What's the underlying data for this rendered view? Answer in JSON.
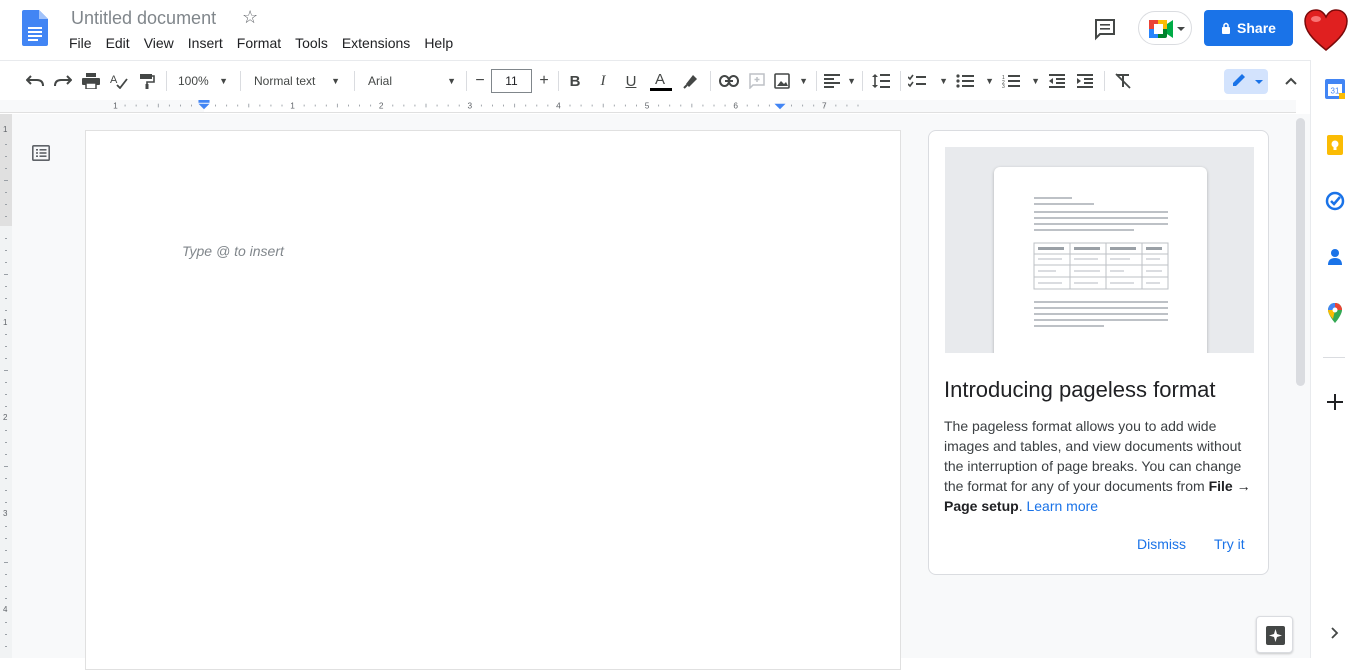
{
  "header": {
    "title": "Untitled document",
    "menu": [
      "File",
      "Edit",
      "View",
      "Insert",
      "Format",
      "Tools",
      "Extensions",
      "Help"
    ],
    "share_label": "Share"
  },
  "toolbar": {
    "zoom": "100%",
    "style": "Normal text",
    "font": "Arial",
    "font_size": "11"
  },
  "ruler": {
    "labels": [
      "1",
      "1",
      "2",
      "3",
      "4",
      "5",
      "6",
      "7"
    ]
  },
  "vruler": {
    "labels": [
      "1",
      "1",
      "2",
      "3",
      "4"
    ]
  },
  "document": {
    "placeholder": "Type @ to insert"
  },
  "promo": {
    "title": "Introducing pageless format",
    "body_1": "The pageless format allows you to add wide images and tables, and view documents without the interruption of page breaks. You can change the format for any of your documents from ",
    "body_bold_1": "File → Page setup",
    "body_2": ". ",
    "learn_more": "Learn more",
    "dismiss": "Dismiss",
    "try_it": "Try it"
  },
  "side_panel": {
    "calendar_day": "31",
    "icons": [
      "calendar-icon",
      "keep-icon",
      "tasks-icon",
      "contacts-icon",
      "maps-icon",
      "add-icon",
      "expand-icon"
    ]
  },
  "colors": {
    "accent": "#1a73e8",
    "share_bg": "#1a73e8",
    "text_color_bar": "#000000"
  }
}
